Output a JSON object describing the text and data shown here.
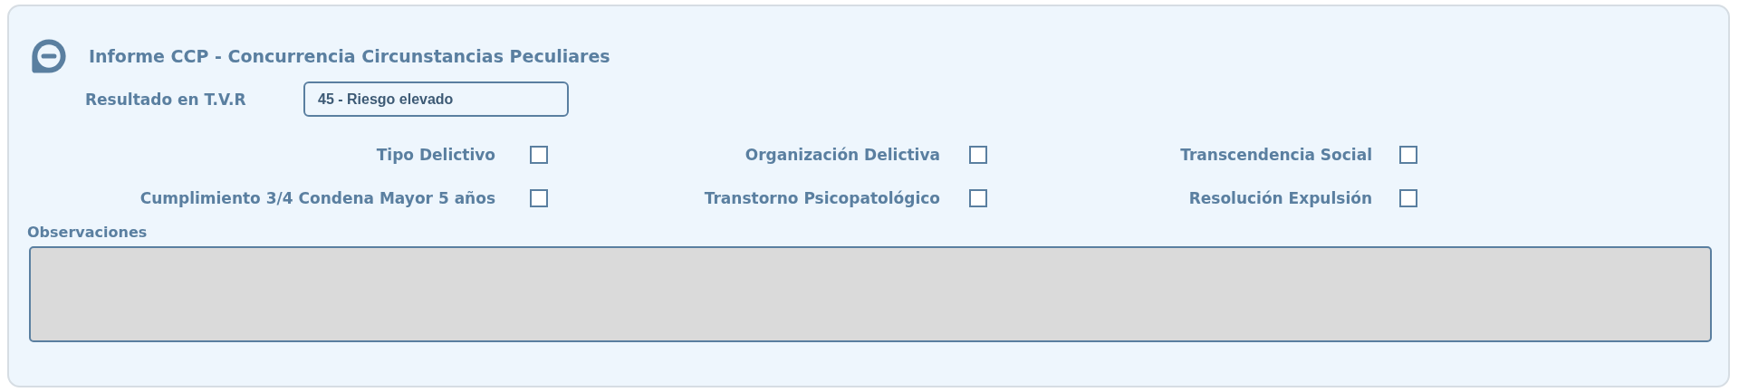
{
  "section": {
    "title": "Informe CCP - Concurrencia Circunstancias Peculiares",
    "expanded": true
  },
  "result_field": {
    "label": "Resultado en T.V.R",
    "value": "45 - Riesgo elevado"
  },
  "checks": [
    {
      "label": "Tipo Delictivo",
      "checked": false
    },
    {
      "label": "Organización Delictiva",
      "checked": false
    },
    {
      "label": "Transcendencia Social",
      "checked": false
    },
    {
      "label": "Cumplimiento 3/4 Condena Mayor 5 años",
      "checked": false
    },
    {
      "label": "Transtorno Psicopatológico",
      "checked": false
    },
    {
      "label": "Resolución Expulsión",
      "checked": false
    }
  ],
  "observations": {
    "label": "Observaciones"
  }
}
